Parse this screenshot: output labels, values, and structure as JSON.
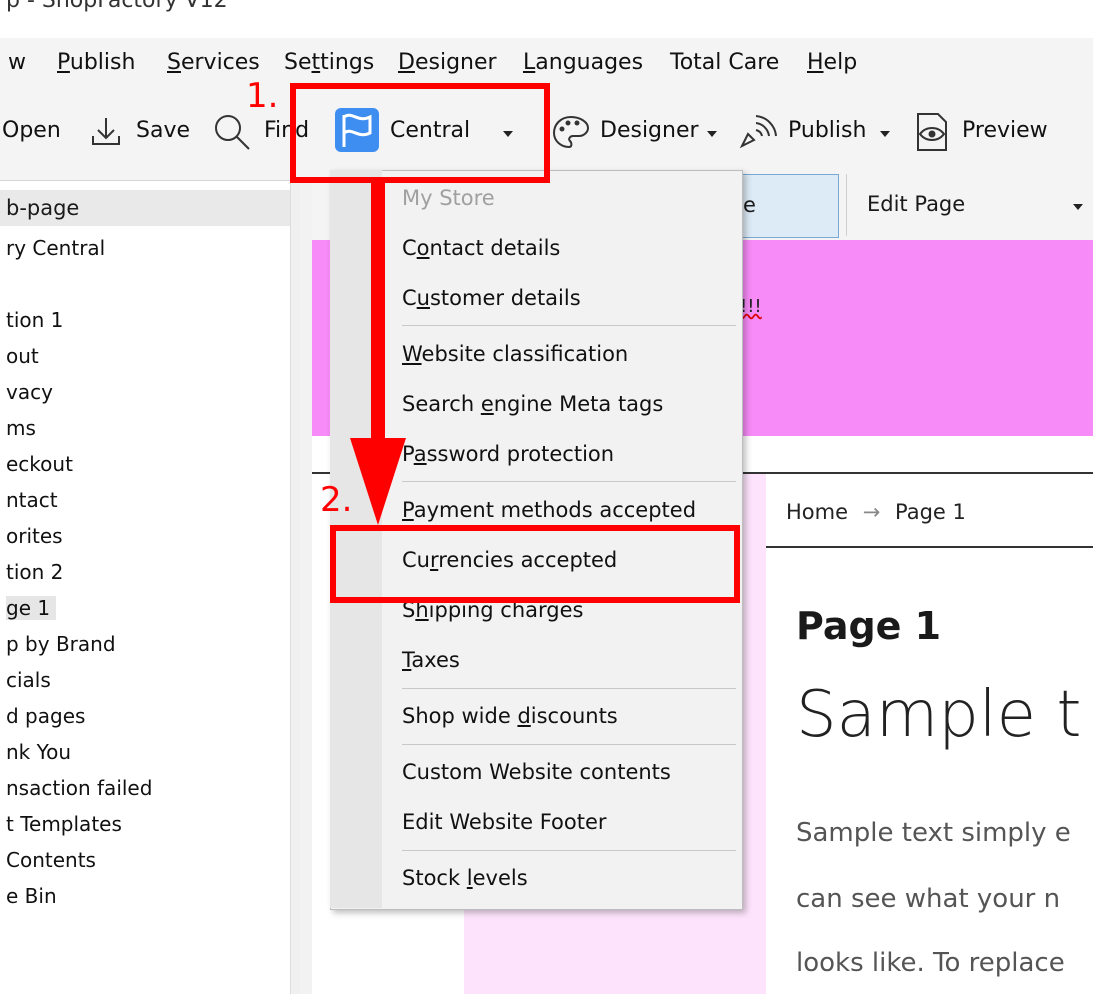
{
  "title_bar": {
    "text": "p - ShopFactory V12"
  },
  "menubar": {
    "items": [
      {
        "label": "w"
      },
      {
        "label": "Publish"
      },
      {
        "label": "Services"
      },
      {
        "label": "Settings"
      },
      {
        "label": "Designer"
      },
      {
        "label": "Languages"
      },
      {
        "label": "Total Care"
      },
      {
        "label": "Help"
      }
    ]
  },
  "toolbar": {
    "open_label": "Open",
    "save_label": "Save",
    "find_label": "Find",
    "central_label": "Central",
    "designer_label": "Designer",
    "publish_label": "Publish",
    "preview_label": "Preview"
  },
  "left_panel": {
    "header": "b-page",
    "items": [
      "ry Central",
      "",
      "tion 1",
      "out",
      "vacy",
      "ms",
      "eckout",
      "ntact",
      "orites",
      "tion 2",
      "ge 1",
      "p by Brand",
      "cials",
      "d pages",
      "nk You",
      "nsaction failed",
      "t Templates",
      "Contents",
      "e Bin"
    ]
  },
  "editor": {
    "active_tab": "e",
    "edit_page_tab": "Edit Page",
    "banner_text": "!!!",
    "breadcrumb": {
      "home": "Home",
      "arrow": "→",
      "page": "Page 1"
    },
    "page_title": "Page 1",
    "sample_heading": "Sample t",
    "body_lines": [
      "Sample text simply e",
      "can see what your n",
      "looks like. To replace"
    ]
  },
  "dropdown": {
    "items": [
      {
        "label": "My Store",
        "disabled": true
      },
      {
        "label": "Contact details"
      },
      {
        "label": "Customer details"
      },
      {
        "label": "Website classification"
      },
      {
        "label": "Search engine Meta tags"
      },
      {
        "label": "Password protection"
      },
      {
        "label": "Payment methods accepted"
      },
      {
        "label": "Currencies accepted"
      },
      {
        "label": "Shipping charges"
      },
      {
        "label": "Taxes"
      },
      {
        "label": "Shop wide discounts"
      },
      {
        "label": "Custom Website contents"
      },
      {
        "label": "Edit Website Footer"
      },
      {
        "label": "Stock levels"
      }
    ]
  },
  "annotations": {
    "step1": "1.",
    "step2": "2.",
    "color": "#ff0000"
  }
}
